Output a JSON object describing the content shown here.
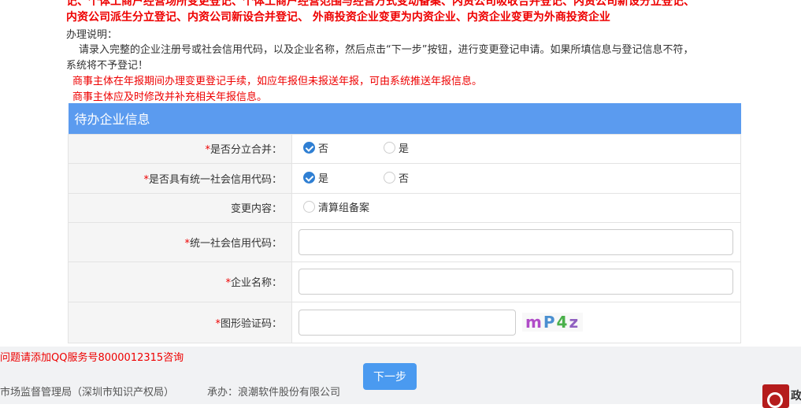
{
  "notice": {
    "line1": "记、个体工商户经营场所变更登记、个体工商户经营范围与经营方式变动备案、内资公司吸收合并登记、内资公司新设分立登记、",
    "line2": "内资公司派生分立登记、内资公司新设合并登记、 外商投资企业变更为内资企业、内资企业变更为外商投资企业",
    "instructions_title": "办理说明：",
    "instructions_1": "请录入完整的企业注册号或社会信用代码，以及企业名称，然后点击“下一步”按钮，进行变更登记申请。如果所填信息与登记信息不符，",
    "instructions_2": "系统将不予登记！",
    "warning_1": "商事主体在年报期间办理变更登记手续，如应年报但未报送年报，可由系统推送年报信息。",
    "warning_2": "商事主体应及时修改并补充相关年报信息。"
  },
  "form": {
    "title": "待办企业信息",
    "required_mark": "*",
    "split_merge": {
      "label": "是否分立合并：",
      "options": [
        "否",
        "是"
      ],
      "selected": "否"
    },
    "has_credit_code": {
      "label": "是否具有统一社会信用代码：",
      "options": [
        "是",
        "否"
      ],
      "selected": "是"
    },
    "change_content": {
      "label": "变更内容：",
      "option": "清算组备案"
    },
    "credit_code": {
      "label": "统一社会信用代码：",
      "value": ""
    },
    "company_name": {
      "label": "企业名称：",
      "value": ""
    },
    "captcha": {
      "label": "图形验证码：",
      "value": "",
      "image_text": "mP4z"
    }
  },
  "footer": {
    "qq_notice": "问题请添加QQ服务号8000012315咨询",
    "next_button": "下一步",
    "org": "市场监督管理局（深圳市知识产权局）",
    "contractor": "承办：浪潮软件股份有限公司",
    "logo_text": "政"
  }
}
